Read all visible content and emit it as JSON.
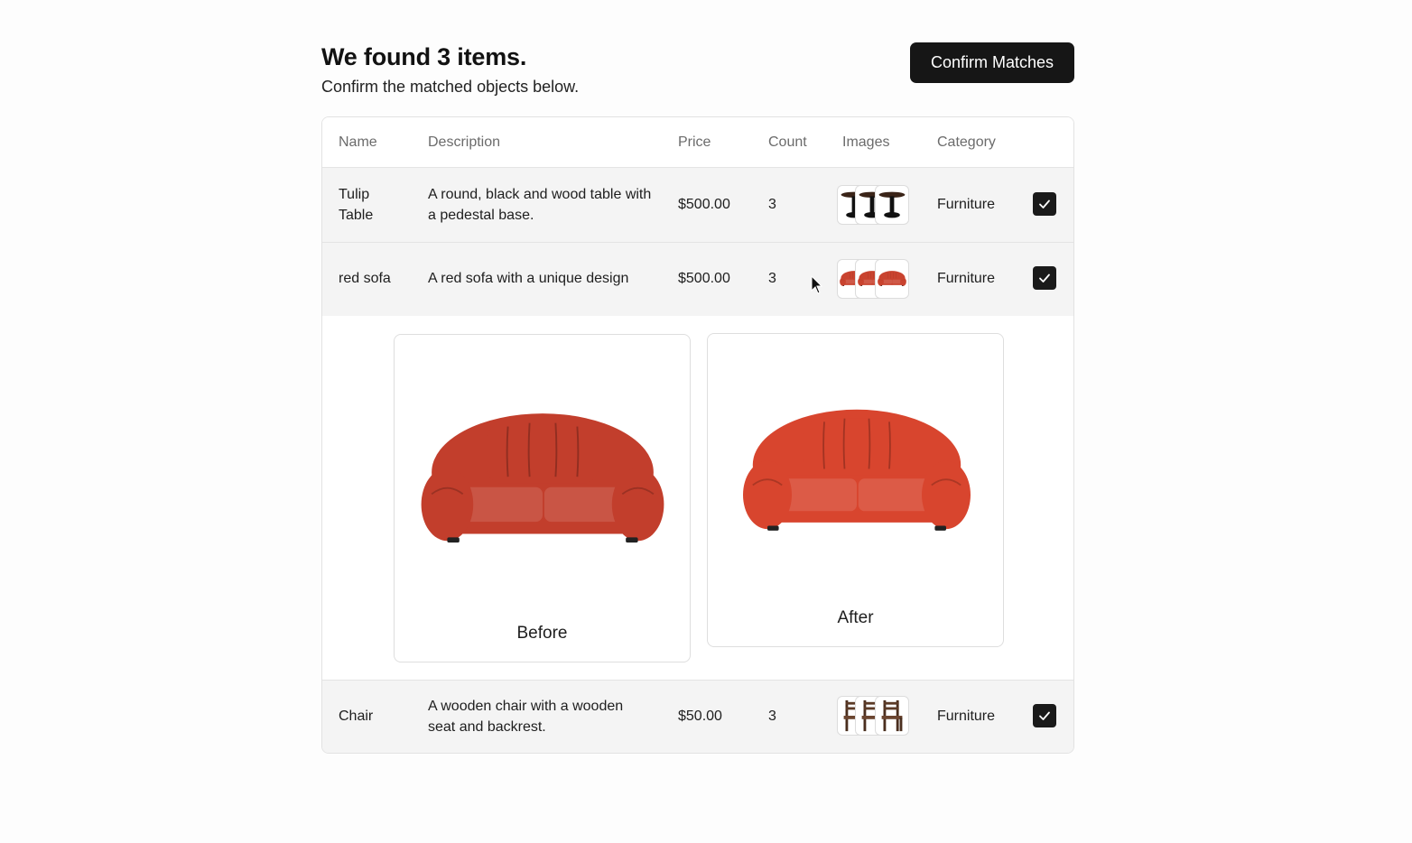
{
  "header": {
    "title": "We found 3 items.",
    "subtitle": "Confirm the matched objects below.",
    "confirm_label": "Confirm Matches"
  },
  "table": {
    "columns": [
      "Name",
      "Description",
      "Price",
      "Count",
      "Images",
      "Category"
    ],
    "rows": [
      {
        "name": "Tulip Table",
        "description": "A round, black and wood table with a pedestal base.",
        "price": "$500.00",
        "count": "3",
        "category": "Furniture",
        "checked": true
      },
      {
        "name": "red sofa",
        "description": "A red sofa with a unique design",
        "price": "$500.00",
        "count": "3",
        "category": "Furniture",
        "checked": true,
        "expanded": true
      },
      {
        "name": "Chair",
        "description": "A wooden chair with a wooden seat and backrest.",
        "price": "$50.00",
        "count": "3",
        "category": "Furniture",
        "checked": true
      }
    ]
  },
  "comparison": {
    "before_label": "Before",
    "after_label": "After"
  },
  "colors": {
    "accent": "#161616",
    "sofa_red": "#c9432f",
    "row_bg": "#f4f4f4"
  }
}
